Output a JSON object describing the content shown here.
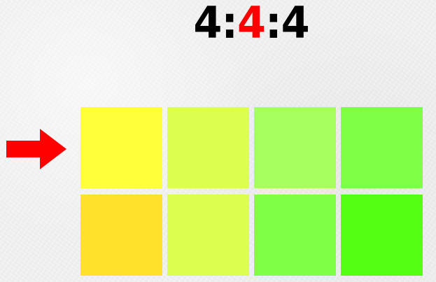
{
  "ratio": {
    "parts": [
      {
        "text": "4",
        "color": "#000000"
      },
      {
        "text": ":",
        "color": "#000000"
      },
      {
        "text": "4",
        "color": "#ff0000"
      },
      {
        "text": ":",
        "color": "#000000"
      },
      {
        "text": "4",
        "color": "#000000"
      }
    ]
  },
  "arrow": {
    "icon": "right-arrow-icon",
    "color": "#ff0000",
    "points_to_row": 1
  },
  "swatches": [
    {
      "row": 1,
      "col": 1,
      "color": "#ffff3a"
    },
    {
      "row": 1,
      "col": 2,
      "color": "#dcff4d"
    },
    {
      "row": 1,
      "col": 3,
      "color": "#a6ff5c"
    },
    {
      "row": 1,
      "col": 4,
      "color": "#7fff45"
    },
    {
      "row": 2,
      "col": 1,
      "color": "#ffe02a"
    },
    {
      "row": 2,
      "col": 2,
      "color": "#dcff4d"
    },
    {
      "row": 2,
      "col": 3,
      "color": "#7fff45"
    },
    {
      "row": 2,
      "col": 4,
      "color": "#55ff14"
    }
  ]
}
